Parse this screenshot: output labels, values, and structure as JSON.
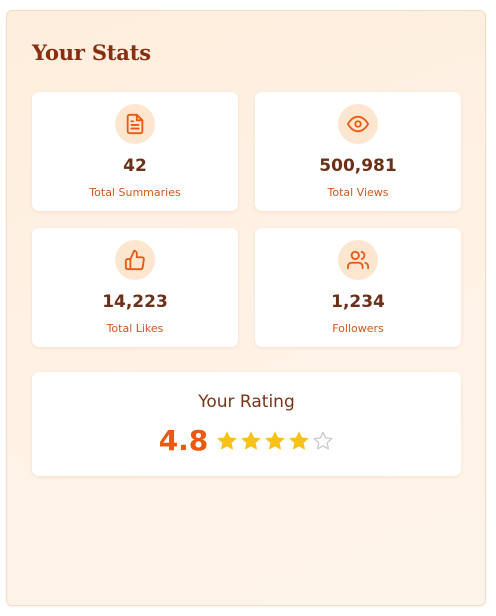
{
  "stats_panel": {
    "title": "Your Stats",
    "cards": [
      {
        "icon": "document-icon",
        "value": "42",
        "label": "Total Summaries"
      },
      {
        "icon": "eye-icon",
        "value": "500,981",
        "label": "Total Views"
      },
      {
        "icon": "thumbs-up-icon",
        "value": "14,223",
        "label": "Total Likes"
      },
      {
        "icon": "users-icon",
        "value": "1,234",
        "label": "Followers"
      }
    ],
    "rating": {
      "title": "Your Rating",
      "value": "4.8",
      "stars_filled": 4,
      "stars_total": 5
    }
  },
  "colors": {
    "accent": "#e9590f",
    "title": "#8a2e12",
    "star_filled": "#f6c217",
    "star_empty": "#c9c9c9",
    "icon_bg": "#fde6cf"
  }
}
